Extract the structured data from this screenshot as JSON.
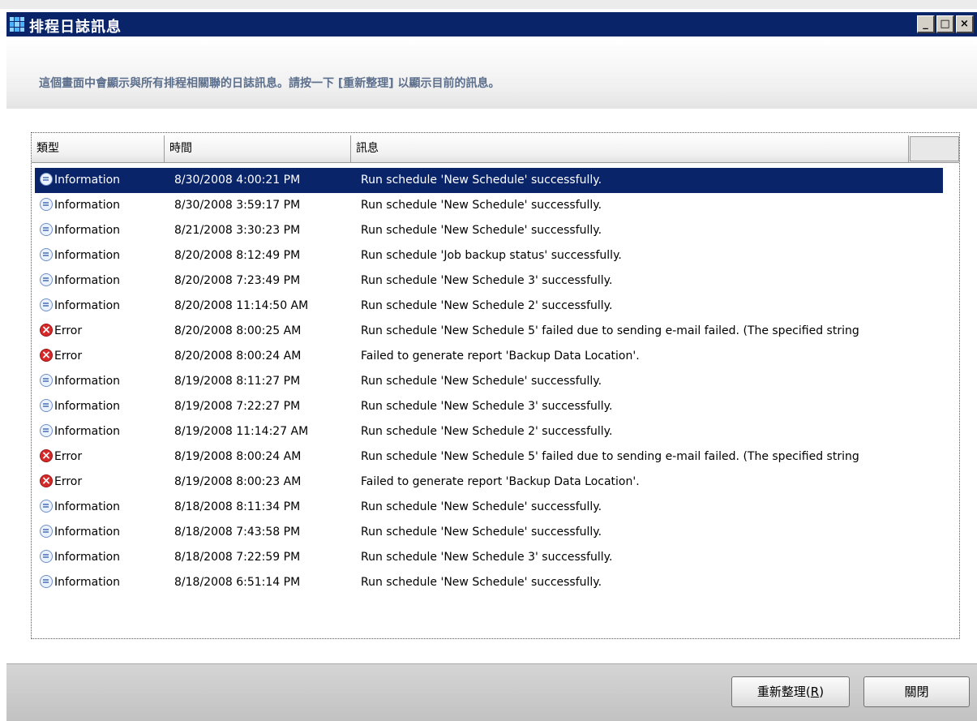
{
  "window": {
    "title": "排程日誌訊息",
    "minimize_label": "_",
    "maximize_label": "□",
    "close_label": "×"
  },
  "description": "這個畫面中會顯示與所有排程相關聯的日誌訊息。請按一下 [重新整理] 以顯示目前的訊息。",
  "columns": {
    "type": "類型",
    "time": "時間",
    "message": "訊息"
  },
  "rows": [
    {
      "type": "Information",
      "icon": "info-icon",
      "time": "8/30/2008 4:00:21 PM",
      "message": "Run schedule 'New Schedule' successfully.",
      "selected": true
    },
    {
      "type": "Information",
      "icon": "info-icon",
      "time": "8/30/2008 3:59:17 PM",
      "message": "Run schedule 'New Schedule' successfully."
    },
    {
      "type": "Information",
      "icon": "info-icon",
      "time": "8/21/2008 3:30:23 PM",
      "message": "Run schedule 'New Schedule' successfully."
    },
    {
      "type": "Information",
      "icon": "info-icon",
      "time": "8/20/2008 8:12:49 PM",
      "message": "Run schedule 'Job backup status' successfully."
    },
    {
      "type": "Information",
      "icon": "info-icon",
      "time": "8/20/2008 7:23:49 PM",
      "message": "Run schedule 'New Schedule 3' successfully."
    },
    {
      "type": "Information",
      "icon": "info-icon",
      "time": "8/20/2008 11:14:50 AM",
      "message": "Run schedule 'New Schedule 2' successfully."
    },
    {
      "type": "Error",
      "icon": "error-icon",
      "time": "8/20/2008 8:00:25 AM",
      "message": "Run schedule 'New Schedule 5' failed due to sending e-mail failed. (The specified string"
    },
    {
      "type": "Error",
      "icon": "error-icon",
      "time": "8/20/2008 8:00:24 AM",
      "message": "Failed to generate report 'Backup Data Location'."
    },
    {
      "type": "Information",
      "icon": "info-icon",
      "time": "8/19/2008 8:11:27 PM",
      "message": "Run schedule 'New Schedule' successfully."
    },
    {
      "type": "Information",
      "icon": "info-icon",
      "time": "8/19/2008 7:22:27 PM",
      "message": "Run schedule 'New Schedule 3' successfully."
    },
    {
      "type": "Information",
      "icon": "info-icon",
      "time": "8/19/2008 11:14:27 AM",
      "message": "Run schedule 'New Schedule 2' successfully."
    },
    {
      "type": "Error",
      "icon": "error-icon",
      "time": "8/19/2008 8:00:24 AM",
      "message": "Run schedule 'New Schedule 5' failed due to sending e-mail failed. (The specified string"
    },
    {
      "type": "Error",
      "icon": "error-icon",
      "time": "8/19/2008 8:00:23 AM",
      "message": "Failed to generate report 'Backup Data Location'."
    },
    {
      "type": "Information",
      "icon": "info-icon",
      "time": "8/18/2008 8:11:34 PM",
      "message": "Run schedule 'New Schedule' successfully."
    },
    {
      "type": "Information",
      "icon": "info-icon",
      "time": "8/18/2008 7:43:58 PM",
      "message": "Run schedule 'New Schedule' successfully."
    },
    {
      "type": "Information",
      "icon": "info-icon",
      "time": "8/18/2008 7:22:59 PM",
      "message": "Run schedule 'New Schedule 3' successfully."
    },
    {
      "type": "Information",
      "icon": "info-icon",
      "time": "8/18/2008 6:51:14 PM",
      "message": "Run schedule 'New Schedule' successfully."
    }
  ],
  "buttons": {
    "refresh_label": "重新整理(",
    "refresh_key": "R",
    "refresh_suffix": ")",
    "close_label": "關閉"
  },
  "colors": {
    "titlebar": "#0a246a",
    "selection": "#0a246a",
    "description_text": "#5c6f8c",
    "error": "#d62a2a"
  }
}
